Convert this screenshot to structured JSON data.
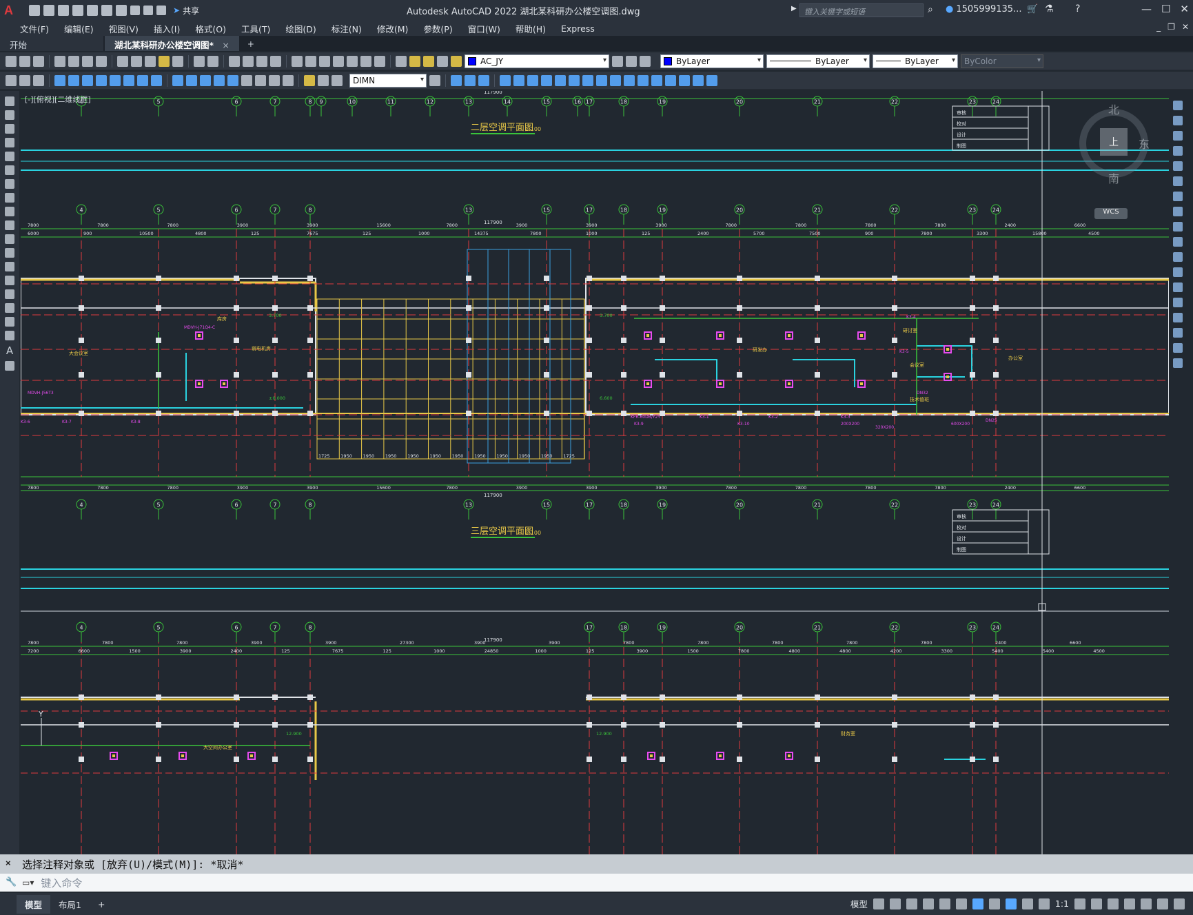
{
  "app": {
    "logo": "A",
    "title": "Autodesk AutoCAD 2022    湖北某科研办公楼空调图.dwg",
    "share_label": "共享",
    "search_placeholder": "键入关键字或短语",
    "user": "1505999135..."
  },
  "menu": [
    "文件(F)",
    "编辑(E)",
    "视图(V)",
    "插入(I)",
    "格式(O)",
    "工具(T)",
    "绘图(D)",
    "标注(N)",
    "修改(M)",
    "参数(P)",
    "窗口(W)",
    "帮助(H)",
    "Express"
  ],
  "tabs": {
    "start": "开始",
    "doc": "湖北某科研办公楼空调图*",
    "close": "×",
    "new": "+"
  },
  "toolbar": {
    "layer": "AC_JY",
    "color": "ByLayer",
    "linetype": "ByLayer",
    "lineweight": "ByLayer",
    "plotstyle": "ByColor",
    "dimstyle": "DIMN"
  },
  "viewport_label": "[-][俯视][二维线框]",
  "viewcube": {
    "north": "北",
    "east": "东",
    "south": "南",
    "center": "上",
    "wcs": "WCS"
  },
  "drawing": {
    "plan2_title": "二层空调平面图",
    "plan3_title": "三层空调平面图",
    "scale": "1:100",
    "total_dim": "117900",
    "axis_top": [
      "4",
      "5",
      "6",
      "7",
      "8",
      "9",
      "10",
      "11",
      "12",
      "13",
      "14",
      "15",
      "16",
      "17",
      "18",
      "19",
      "20",
      "21",
      "22",
      "23",
      "24"
    ],
    "axis_plan": [
      "4",
      "5",
      "6",
      "7",
      "8",
      "13",
      "15",
      "17",
      "18",
      "19",
      "20",
      "21",
      "22",
      "23",
      "24"
    ],
    "axis_plan3": [
      "4",
      "5",
      "6",
      "7",
      "8",
      "17",
      "18",
      "19",
      "20",
      "21",
      "22",
      "23",
      "24"
    ],
    "dims_row1": [
      "7800",
      "7800",
      "7800",
      "3900",
      "3900",
      "15600",
      "7800",
      "3900",
      "3900",
      "3900",
      "7800",
      "7800",
      "7800",
      "7800",
      "2400",
      "6600"
    ],
    "dims_row2": [
      "6000",
      "900",
      "10500",
      "4800",
      "125",
      "7675",
      "125",
      "1000",
      "14375",
      "7800",
      "1000",
      "125",
      "2400",
      "5700",
      "7500",
      "900",
      "7800",
      "3300",
      "15800",
      "4500"
    ],
    "dims_bottom": [
      "1725",
      "1950",
      "1950",
      "1950",
      "1950",
      "1950",
      "1950",
      "1950",
      "1950",
      "1950",
      "1950",
      "1725"
    ],
    "dims_row3": [
      "7800",
      "7800",
      "7800",
      "3900",
      "3900",
      "27300",
      "3900",
      "3900",
      "7800",
      "7800",
      "7800",
      "7800",
      "7800",
      "2400",
      "6600"
    ],
    "dims_row3b": [
      "7200",
      "6600",
      "1500",
      "3900",
      "2400",
      "125",
      "7675",
      "125",
      "1000",
      "24850",
      "1000",
      "125",
      "3900",
      "1500",
      "7800",
      "4800",
      "4800",
      "4200",
      "3300",
      "5400",
      "5400",
      "4500"
    ],
    "room_labels": [
      "大会议室",
      "库房",
      "弱电机房",
      "研发办",
      "研讨室",
      "会议室",
      "技术值班",
      "办公室",
      "大空间办公室",
      "财务室"
    ],
    "elev_labels": [
      "3.700",
      "3.700",
      "±0.000",
      "6.600",
      "12.900",
      "12.900"
    ],
    "equipment": [
      "MDVH-J71Q4-C",
      "MDVH-J56T3",
      "KFR-60DB/Y2Y",
      "K3-1",
      "K3-2",
      "K3-3",
      "K3-4",
      "K3-5",
      "K3-6",
      "K3-7",
      "K3-8",
      "K3-9",
      "K3-10",
      "200X200",
      "320X200",
      "600X200",
      "DN25",
      "DN32"
    ],
    "stamp_rows": [
      "审核",
      "校对",
      "设计",
      "制图"
    ]
  },
  "cmd": {
    "history": "选择注释对象或 [放弃(U)/模式(M)]: *取消*",
    "placeholder": "键入命令",
    "close": "×"
  },
  "status": {
    "model": "模型",
    "layout1": "布局1",
    "add": "+",
    "model_btn": "模型",
    "scale": "1:1"
  }
}
